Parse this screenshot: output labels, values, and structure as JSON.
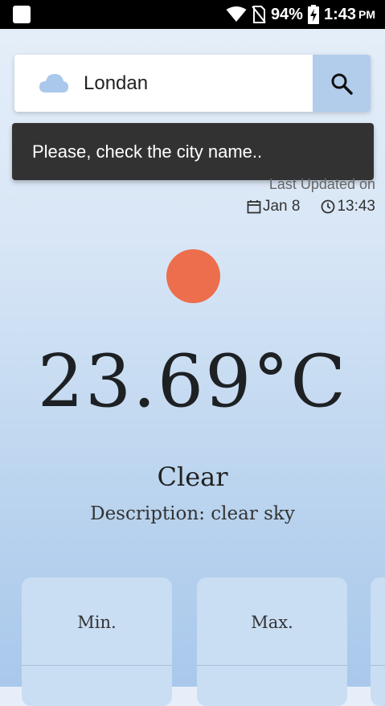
{
  "status_bar": {
    "battery": "94%",
    "time": "1:43",
    "ampm": "PM",
    "icons": [
      "app-square-icon",
      "wifi-icon",
      "no-sim-icon",
      "battery-charging-icon"
    ]
  },
  "search": {
    "value": "Londan",
    "placeholder": "",
    "icon": "cloud-icon",
    "button_icon": "search-icon"
  },
  "toast": {
    "message": "Please, check the city name.."
  },
  "updated": {
    "label": "Last Updated on",
    "date": "Jan 8",
    "time": "13:43",
    "date_icon": "calendar-icon",
    "time_icon": "clock-icon"
  },
  "weather": {
    "icon": "sun-icon",
    "temperature": "23.69°C",
    "condition": "Clear",
    "description": "Description: clear sky"
  },
  "cards": [
    {
      "label": "Min."
    },
    {
      "label": "Max."
    }
  ],
  "colors": {
    "accent": "#b1cdeb",
    "sun": "#ec6e4c",
    "toast_bg": "#323232",
    "card_bg": "#c9ddf3"
  }
}
